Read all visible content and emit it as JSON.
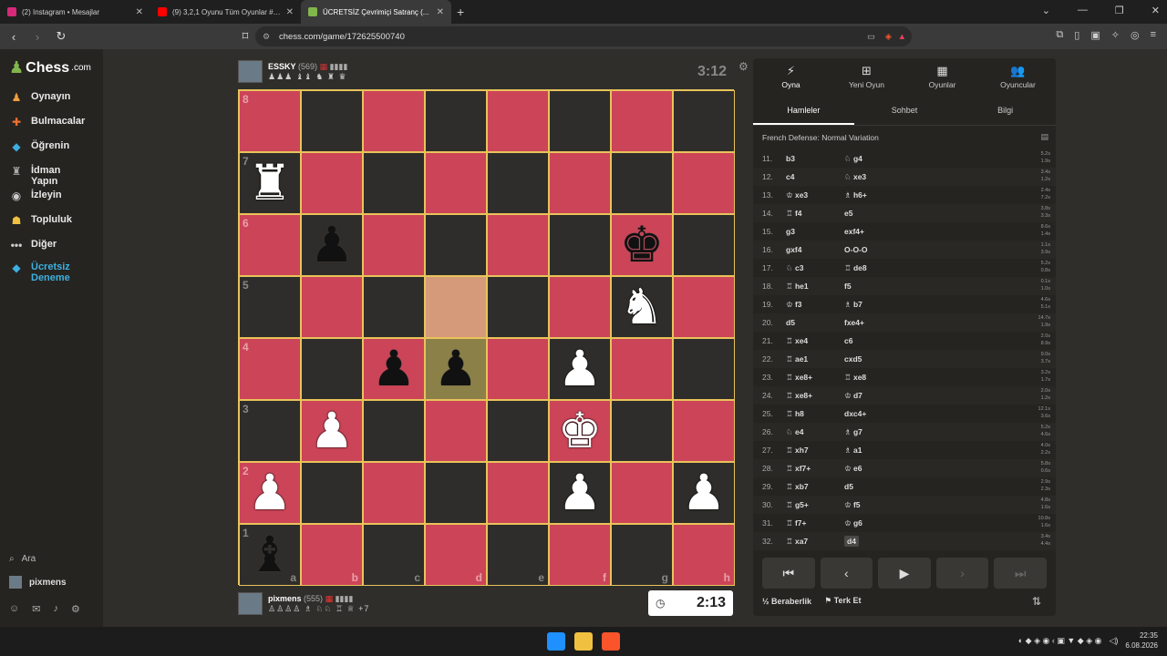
{
  "browser": {
    "tabs": [
      {
        "label": "(2) Instagram • Mesajlar",
        "color": "#d6297a"
      },
      {
        "label": "(9) 3,2,1 Oyunu Tüm Oyunlar #9 | Ht...",
        "color": "#ff0000"
      },
      {
        "label": "ÜCRETSİZ Çevrimiçi Satranç (...",
        "color": "#81b64c",
        "active": true
      }
    ],
    "url": "chess.com/game/172625500740"
  },
  "sidebar": {
    "logo_text": "Chess",
    "logo_suffix": ".com",
    "items": [
      {
        "label": "Oynayın",
        "icon": "play-icon",
        "glyph": "♟",
        "color": "#f0a040"
      },
      {
        "label": "Bulmacalar",
        "icon": "puzzle-icon",
        "glyph": "✚",
        "color": "#f07030"
      },
      {
        "label": "Öğrenin",
        "icon": "learn-icon",
        "glyph": "◆",
        "color": "#3daee0"
      },
      {
        "label": "İdman Yapın",
        "icon": "train-icon",
        "glyph": "♜",
        "color": "#aaa"
      },
      {
        "label": "İzleyin",
        "icon": "watch-icon",
        "glyph": "◉",
        "color": "#ccc"
      },
      {
        "label": "Topluluk",
        "icon": "community-icon",
        "glyph": "☗",
        "color": "#f0c040"
      },
      {
        "label": "Diğer",
        "icon": "more-icon",
        "glyph": "•••",
        "color": "#ccc"
      },
      {
        "label": "Ücretsiz Deneme",
        "icon": "diamond-icon",
        "glyph": "◆",
        "color": "#3db0e0"
      }
    ],
    "search_label": "Ara",
    "user_label": "pixmens"
  },
  "game": {
    "top_player": {
      "name": "ESSKY",
      "rating": "(569)",
      "captured": "♟♟♟ ♝♝ ♞ ♜ ♛",
      "clock": "3:12"
    },
    "bottom_player": {
      "name": "pixmens",
      "rating": "(555)",
      "captured": "♙♙♙♙ ♗ ♘♘ ♖ ♕",
      "extra": "+7",
      "clock": "2:13"
    },
    "ranks": [
      "8",
      "7",
      "6",
      "5",
      "4",
      "3",
      "2",
      "1"
    ],
    "files": [
      "a",
      "b",
      "c",
      "d",
      "e",
      "f",
      "g",
      "h"
    ],
    "pieces": {
      "a7": "♜w",
      "b6": "♟b",
      "g6": "♚b",
      "g5": "♞w",
      "c4": "♟b",
      "d4": "♟b",
      "f4": "♟w",
      "b3": "♟w",
      "f3": "♚w",
      "a2": "♟w",
      "f2": "♟w",
      "h2": "♟w",
      "a1": "♝b"
    },
    "highlight": [
      "d5",
      "d4"
    ]
  },
  "panel": {
    "nav": [
      {
        "label": "Oyna",
        "icon": "bolt-icon",
        "glyph": "⚡"
      },
      {
        "label": "Yeni Oyun",
        "icon": "new-game-icon",
        "glyph": "⊞"
      },
      {
        "label": "Oyunlar",
        "icon": "games-icon",
        "glyph": "▦"
      },
      {
        "label": "Oyuncular",
        "icon": "players-icon",
        "glyph": "👥"
      }
    ],
    "subtabs": [
      "Hamleler",
      "Sohbet",
      "Bilgi"
    ],
    "opening": "French Defense: Normal Variation",
    "moves": [
      {
        "n": "11.",
        "w": "b3",
        "b": "♘ g4",
        "tw": "5.2s",
        "tb": "1.9s"
      },
      {
        "n": "12.",
        "w": "c4",
        "b": "♘ xe3",
        "tw": "3.4s",
        "tb": "1.2s"
      },
      {
        "n": "13.",
        "w": "♔ xe3",
        "b": "♗ h6+",
        "tw": "2.4s",
        "tb": "7.2s"
      },
      {
        "n": "14.",
        "w": "♖ f4",
        "b": "e5",
        "tw": "3.8s",
        "tb": "3.3s"
      },
      {
        "n": "15.",
        "w": "g3",
        "b": "exf4+",
        "tw": "8.6s",
        "tb": "1.4s"
      },
      {
        "n": "16.",
        "w": "gxf4",
        "b": "O-O-O",
        "tw": "1.1s",
        "tb": "3.9s"
      },
      {
        "n": "17.",
        "w": "♘ c3",
        "b": "♖ de8",
        "tw": "5.2s",
        "tb": "0.8s"
      },
      {
        "n": "18.",
        "w": "♖ he1",
        "b": "f5",
        "tw": "0.1s",
        "tb": "1.0s"
      },
      {
        "n": "19.",
        "w": "♔ f3",
        "b": "♗ b7",
        "tw": "4.6s",
        "tb": "5.1s"
      },
      {
        "n": "20.",
        "w": "d5",
        "b": "fxe4+",
        "tw": "14.7s",
        "tb": "1.9s"
      },
      {
        "n": "21.",
        "w": "♖ xe4",
        "b": "c6",
        "tw": "2.0s",
        "tb": "8.9s"
      },
      {
        "n": "22.",
        "w": "♖ ae1",
        "b": "cxd5",
        "tw": "9.0s",
        "tb": "3.7s"
      },
      {
        "n": "23.",
        "w": "♖ xe8+",
        "b": "♖ xe8",
        "tw": "3.2s",
        "tb": "1.7s"
      },
      {
        "n": "24.",
        "w": "♖ xe8+",
        "b": "♔ d7",
        "tw": "2.0s",
        "tb": "1.2s"
      },
      {
        "n": "25.",
        "w": "♖ h8",
        "b": "dxc4+",
        "tw": "12.1s",
        "tb": "3.6s"
      },
      {
        "n": "26.",
        "w": "♘ e4",
        "b": "♗ g7",
        "tw": "5.2s",
        "tb": "4.6s"
      },
      {
        "n": "27.",
        "w": "♖ xh7",
        "b": "♗ a1",
        "tw": "4.0s",
        "tb": "2.2s"
      },
      {
        "n": "28.",
        "w": "♖ xf7+",
        "b": "♔ e6",
        "tw": "5.8s",
        "tb": "0.6s"
      },
      {
        "n": "29.",
        "w": "♖ xb7",
        "b": "d5",
        "tw": "2.9s",
        "tb": "2.3s"
      },
      {
        "n": "30.",
        "w": "♖ g5+",
        "b": "♔ f5",
        "tw": "4.8s",
        "tb": "1.6s"
      },
      {
        "n": "31.",
        "w": "♖ f7+",
        "b": "♔ g6",
        "tw": "10.8s",
        "tb": "1.6s"
      },
      {
        "n": "32.",
        "w": "♖ xa7",
        "b": "d4",
        "tw": "3.4s",
        "tb": "4.4s",
        "cur": true
      }
    ],
    "draw_label": "Beraberlik",
    "resign_label": "Terk Et"
  },
  "taskbar": {
    "time": "22:35",
    "date": "6.08.2026"
  }
}
